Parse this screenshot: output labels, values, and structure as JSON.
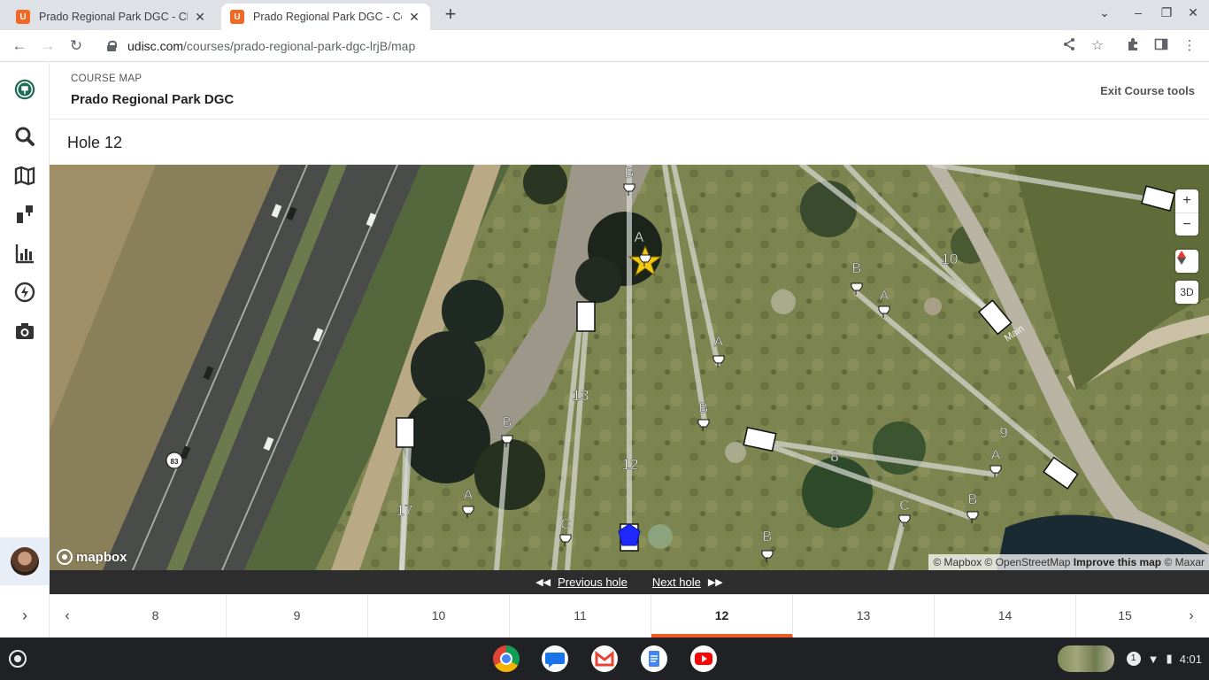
{
  "browser": {
    "tabs": [
      {
        "title": "Prado Regional Park DGC - Chin",
        "favicon": "U"
      },
      {
        "title": "Prado Regional Park DGC - Cour",
        "favicon": "U"
      }
    ],
    "new_tab": "+",
    "url_host": "udisc.com",
    "url_path": "/courses/prado-regional-park-dgc-lrjB/map"
  },
  "header": {
    "eyebrow": "COURSE MAP",
    "course_name": "Prado Regional Park DGC",
    "exit_label": "Exit Course tools"
  },
  "hole": {
    "title": "Hole 12"
  },
  "map": {
    "zoom_in": "+",
    "zoom_out": "−",
    "pitch_toggle": "3D",
    "logo_text": "mapbox",
    "attribution": {
      "mapbox": "© Mapbox",
      "osm": "© OpenStreetMap",
      "improve": "Improve this map",
      "maxar": "© Maxar"
    },
    "hole_numbers": [
      "13",
      "12",
      "17",
      "10",
      "9",
      "8"
    ],
    "route_shield": "83",
    "road_labels": [
      "Main"
    ],
    "basket_labels": {
      "tl_b": "B",
      "star_a": "A",
      "a_mid": "A",
      "b_mid": "B",
      "b_upper_right": "B",
      "a_upper_right": "A",
      "b_left": "B",
      "a_left": "A",
      "c_bottom": "C",
      "b_bottom": "B",
      "c_right": "C",
      "a_right": "A",
      "b_right": "B"
    },
    "colors": {
      "star": "#f2c811",
      "tee_marker": "#1f28ff"
    }
  },
  "hole_nav": {
    "previous_label": "Previous hole",
    "next_label": "Next hole",
    "prev_arrow": "◀◀",
    "next_arrow": "▶▶"
  },
  "hole_tabs": {
    "items": [
      "8",
      "9",
      "10",
      "11",
      "12",
      "13",
      "14",
      "15"
    ],
    "active": "12",
    "accent": "#f05a22"
  },
  "shelf": {
    "time": "4:01",
    "notification_count": "1"
  }
}
